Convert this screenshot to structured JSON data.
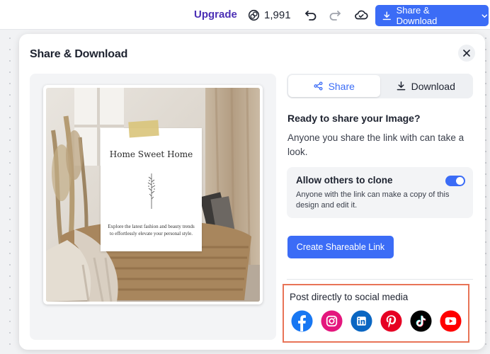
{
  "topbar": {
    "upgrade_label": "Upgrade",
    "credits_count": "1,991",
    "share_download_label": "Share & Download"
  },
  "modal": {
    "title": "Share & Download",
    "tabs": [
      {
        "label": "Share",
        "icon": "share-icon",
        "active": true
      },
      {
        "label": "Download",
        "icon": "download-icon",
        "active": false
      }
    ],
    "ready_title": "Ready to share your Image?",
    "ready_desc": "Anyone you share the link with can take a look.",
    "clone": {
      "title": "Allow others to clone",
      "desc": "Anyone with the link can make a copy of this design and edit it.",
      "enabled": true
    },
    "create_link_label": "Create Shareable Link",
    "social": {
      "title": "Post directly to social media",
      "platforms": [
        "facebook-icon",
        "instagram-icon",
        "linkedin-icon",
        "pinterest-icon",
        "tiktok-icon",
        "youtube-icon"
      ]
    }
  },
  "preview": {
    "card_title": "Home Sweet Home",
    "card_text": "Explore the latest fashion and beauty trends to effortlessly elevate your personal style."
  },
  "colors": {
    "accent": "#3b6cf6",
    "upgrade": "#4b2fb5",
    "highlight_border": "#e87457"
  }
}
